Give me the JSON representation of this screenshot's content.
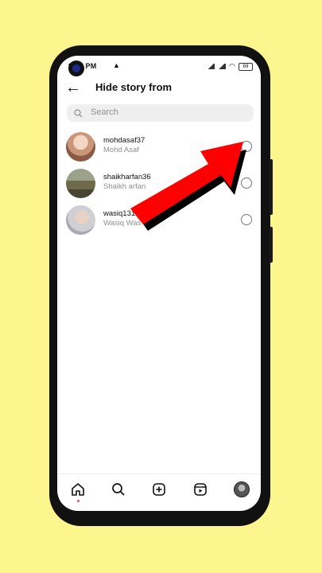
{
  "status_bar": {
    "time": "9:_7 PM",
    "battery": "69"
  },
  "header": {
    "title": "Hide story from",
    "back_icon": "arrow-left-icon"
  },
  "search": {
    "placeholder": "Search"
  },
  "users": [
    {
      "username": "mohdasaf37",
      "full_name": "Mohd Asaf",
      "selected": false
    },
    {
      "username": "shaikharfan36",
      "full_name": "Shaikh arfan",
      "selected": false
    },
    {
      "username": "wasiq131",
      "full_name": "Wasiq Was",
      "selected": false
    }
  ],
  "bottom_nav": [
    "home-icon",
    "search-icon",
    "create-icon",
    "reels-icon",
    "profile-avatar"
  ],
  "colors": {
    "background": "#fdf58e",
    "annotation_arrow": "#ff0000",
    "notification_dot": "#ed4956"
  }
}
